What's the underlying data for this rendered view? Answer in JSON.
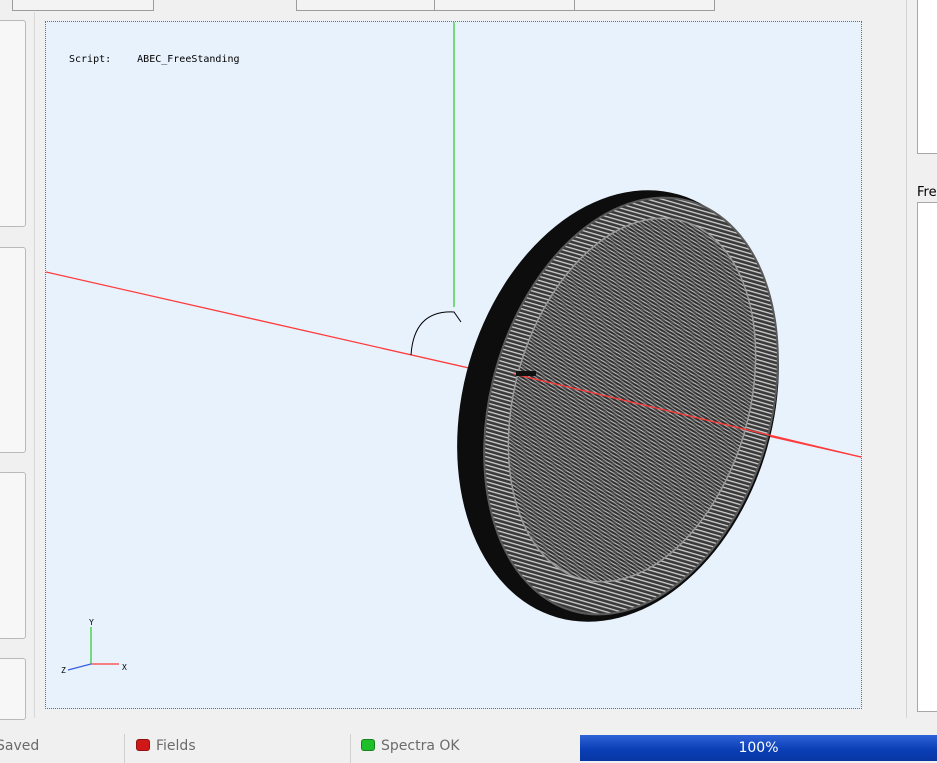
{
  "viewport": {
    "script_label": "Script:",
    "script_name": "ABEC_FreeStanding",
    "axis_y": "Y",
    "axis_x": "X",
    "axis_z": "Z",
    "axis_colors": {
      "x": "#ff3b3b",
      "y": "#38cc38",
      "z": "#3a5fe0"
    },
    "background": "#e8f2fd"
  },
  "right_panel": {
    "label": "Fre"
  },
  "status": {
    "saved": "Saved",
    "fields": "Fields",
    "fields_led": "#d01818",
    "spectra": "Spectra OK",
    "spectra_led": "#1fbf2a",
    "progress_text": "100%",
    "progress_value": 1.0
  }
}
